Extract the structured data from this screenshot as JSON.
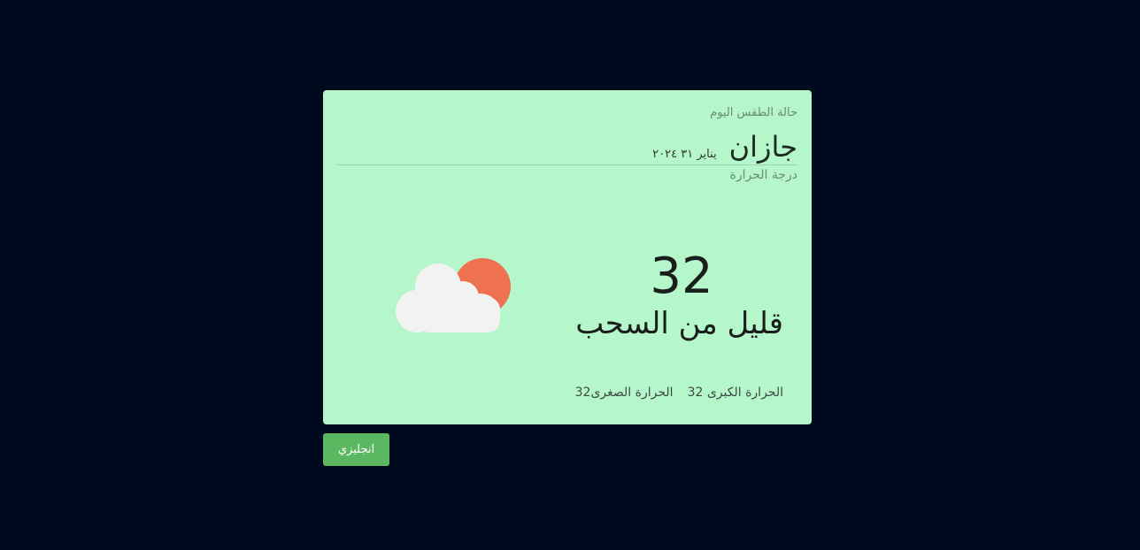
{
  "weather": {
    "subtitle": "حالة الطقس اليوم",
    "city": "جازان",
    "date": "يناير ٣١ ٢٠٢٤",
    "temp_label": "درجة الحرارة",
    "temperature": "32",
    "condition": "قليل من السحب",
    "max_temp": "الحرارة الكبرى 32",
    "min_temp": "الحرارة الصغرى32",
    "icon": "few-clouds-icon"
  },
  "language_button": {
    "label": "انجليزي"
  },
  "colors": {
    "page_background": "#000a1e",
    "card_background": "#b5f7cb",
    "button_background": "#5cb860",
    "sun": "#ee7150",
    "cloud": "#f2f2f2"
  }
}
